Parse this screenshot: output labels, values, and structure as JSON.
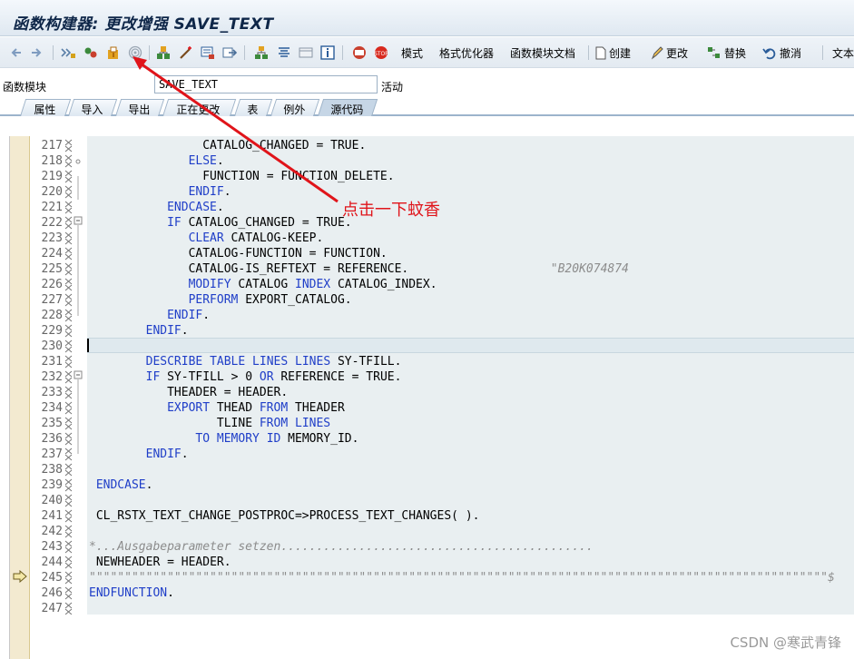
{
  "window": {
    "title": "函数构建器: 更改增强 SAVE_TEXT"
  },
  "toolbar": {
    "mode_label": "模式",
    "pretty_printer_label": "格式优化器",
    "doc_label": "函数模块文档",
    "create_label": "创建",
    "change_label": "更改",
    "replace_label": "替换",
    "undo_label": "撤消",
    "text_label": "文本"
  },
  "field": {
    "label": "函数模块",
    "value": "SAVE_TEXT",
    "status": "活动"
  },
  "tabs": [
    "属性",
    "导入",
    "导出",
    "正在更改",
    "表",
    "例外",
    "源代码"
  ],
  "active_tab": "源代码",
  "code": [
    {
      "no": "217",
      "text": "                CATALOG_CHANGED = TRUE."
    },
    {
      "no": "218",
      "text": "              ELSE."
    },
    {
      "no": "219",
      "text": "                FUNCTION = FUNCTION_DELETE."
    },
    {
      "no": "220",
      "text": "              ENDIF."
    },
    {
      "no": "221",
      "text": "           ENDCASE."
    },
    {
      "no": "222",
      "text": "           IF CATALOG_CHANGED = TRUE."
    },
    {
      "no": "223",
      "text": "              CLEAR CATALOG-KEEP."
    },
    {
      "no": "224",
      "text": "              CATALOG-FUNCTION = FUNCTION."
    },
    {
      "no": "225",
      "text": "              CATALOG-IS_REFTEXT = REFERENCE.                    \"B20K074874"
    },
    {
      "no": "226",
      "text": "              MODIFY CATALOG INDEX CATALOG_INDEX."
    },
    {
      "no": "227",
      "text": "              PERFORM EXPORT_CATALOG."
    },
    {
      "no": "228",
      "text": "           ENDIF."
    },
    {
      "no": "229",
      "text": "        ENDIF."
    },
    {
      "no": "230",
      "text": ""
    },
    {
      "no": "231",
      "text": "        DESCRIBE TABLE LINES LINES SY-TFILL."
    },
    {
      "no": "232",
      "text": "        IF SY-TFILL > 0 OR REFERENCE = TRUE."
    },
    {
      "no": "233",
      "text": "           THEADER = HEADER."
    },
    {
      "no": "234",
      "text": "           EXPORT THEAD FROM THEADER"
    },
    {
      "no": "235",
      "text": "                  TLINE FROM LINES"
    },
    {
      "no": "236",
      "text": "               TO MEMORY ID MEMORY_ID."
    },
    {
      "no": "237",
      "text": "        ENDIF."
    },
    {
      "no": "238",
      "text": ""
    },
    {
      "no": "239",
      "text": " ENDCASE."
    },
    {
      "no": "240",
      "text": ""
    },
    {
      "no": "241",
      "text": " CL_RSTX_TEXT_CHANGE_POSTPROC=>PROCESS_TEXT_CHANGES( )."
    },
    {
      "no": "242",
      "text": ""
    },
    {
      "no": "243",
      "text": "*...Ausgabeparameter setzen............................................"
    },
    {
      "no": "244",
      "text": " NEWHEADER = HEADER."
    },
    {
      "no": "245",
      "text": "\"\"\"\"\"\"\"\"\"\"\"\"\"\"\"\"\"\"\"\"\"\"\"\"\"\"\"\"\"\"\"\"\"\"\"\"\"\"\"\"\"\"\"\"\"\"\"\"\"\"\"\"\"\"\"\"\"\"\"\"\"\"\"\"\"\"\"\"\"\"\"\"\"\"\"\"\"\"\"\"\"\"\"\"\"\"\"\"\"\"\"\"\"\"\"\"\"\"\"\"\"\"\"\"$"
    },
    {
      "no": "246",
      "text": "ENDFUNCTION."
    },
    {
      "no": "247",
      "text": ""
    }
  ],
  "annotation": "点击一下蚊香",
  "watermark": "CSDN @寒武青锋",
  "colors": {
    "keyword": "#1f3ec8",
    "comment": "#8c8c8c",
    "annotation": "#e0141a",
    "editor_bg": "#e9eff1"
  }
}
